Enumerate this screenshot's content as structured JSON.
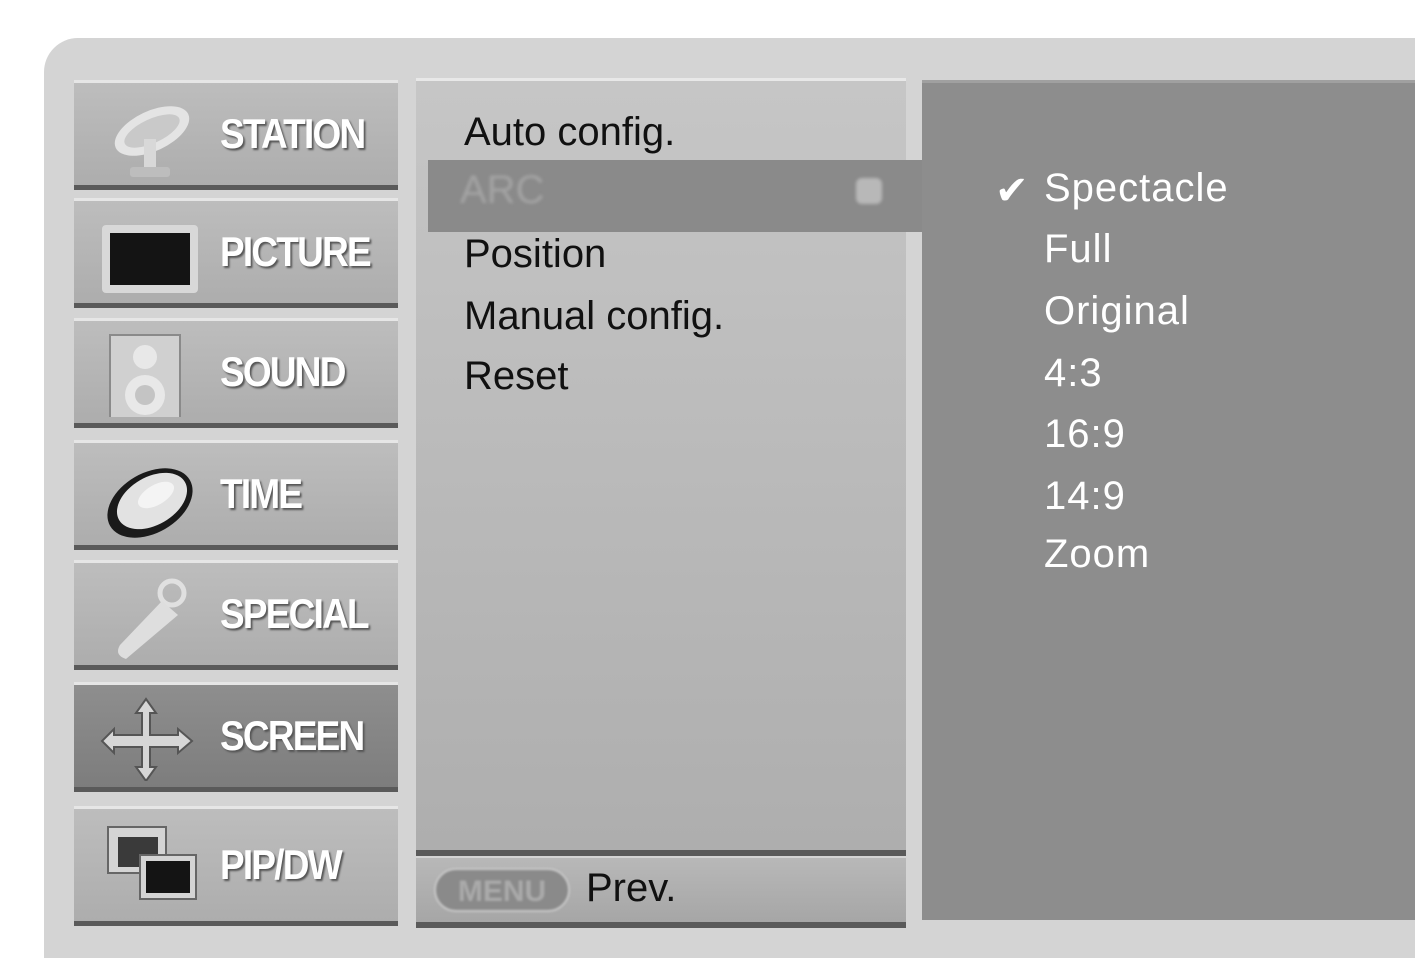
{
  "categories": [
    {
      "label": "STATION",
      "icon": "satellite-dish-icon"
    },
    {
      "label": "PICTURE",
      "icon": "tv-screen-icon"
    },
    {
      "label": "SOUND",
      "icon": "speaker-icon"
    },
    {
      "label": "TIME",
      "icon": "clock-icon"
    },
    {
      "label": "SPECIAL",
      "icon": "key-tag-icon"
    },
    {
      "label": "SCREEN",
      "icon": "move-arrows-icon",
      "active": true
    },
    {
      "label": "PIP/DW",
      "icon": "pip-windows-icon"
    }
  ],
  "submenu": {
    "items": [
      "Auto config.",
      "ARC",
      "Position",
      "Manual config.",
      "Reset"
    ],
    "selected": "ARC"
  },
  "footer": {
    "button_label": "MENU",
    "action_label": "Prev."
  },
  "options": {
    "items": [
      "Spectacle",
      "Full",
      "Original",
      "4:3",
      "16:9",
      "14:9",
      "Zoom"
    ],
    "checked": "Spectacle",
    "check_glyph": "✔"
  }
}
